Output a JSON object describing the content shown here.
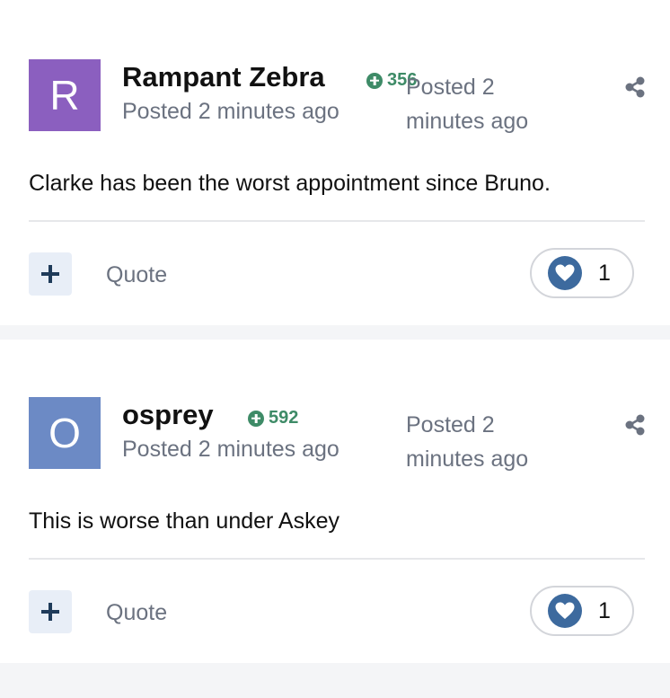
{
  "posts": [
    {
      "avatar_letter": "R",
      "avatar_color": "#8b5fbf",
      "username": "Rampant Zebra",
      "reputation": "356",
      "posted_sub": "Posted 2 minutes ago",
      "posted_side": "Posted 2 minutes ago",
      "content": "Clarke has been the worst appointment since Bruno.",
      "quote_label": "Quote",
      "reaction_count": "1",
      "icons": [
        "reputation-plus-icon",
        "share-icon",
        "plus-icon",
        "heart-icon"
      ]
    },
    {
      "avatar_letter": "O",
      "avatar_color": "#6c8ac5",
      "username": "osprey",
      "reputation": "592",
      "posted_sub": "Posted 2 minutes ago",
      "posted_side": "Posted 2 minutes ago",
      "content": "This is worse than under Askey",
      "quote_label": "Quote",
      "reaction_count": "1",
      "icons": [
        "reputation-plus-icon",
        "share-icon",
        "plus-icon",
        "heart-icon"
      ]
    }
  ],
  "colors": {
    "reputation_green": "#3e8b67",
    "muted_text": "#6b7280",
    "heart_blue": "#3d6a9e",
    "plus_dark": "#1f3b5a"
  }
}
